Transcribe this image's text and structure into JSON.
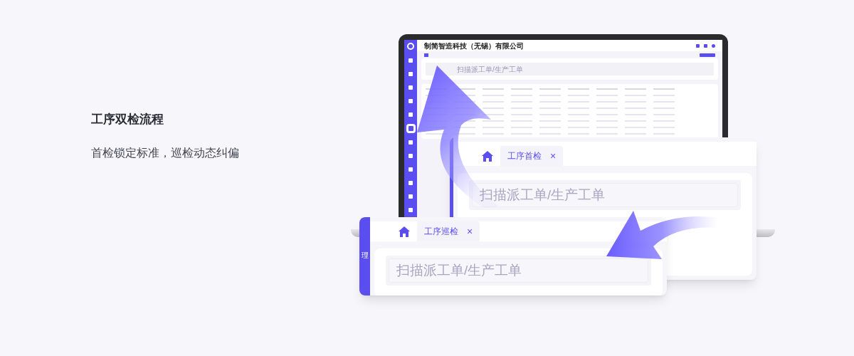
{
  "heading": "工序双检流程",
  "subheading": "首检锁定标准，巡检动态纠偏",
  "laptop_screen": {
    "company": "制简智造科技（无锡）有限公司",
    "search_placeholder": "扫描派工单/生产工单"
  },
  "panels": [
    {
      "tab": "工序首检",
      "close": "×",
      "placeholder": "扫描派工单/生产工单"
    },
    {
      "tab": "工序巡检",
      "close": "×",
      "placeholder": "扫描派工单/生产工单",
      "side_label": "理"
    }
  ]
}
